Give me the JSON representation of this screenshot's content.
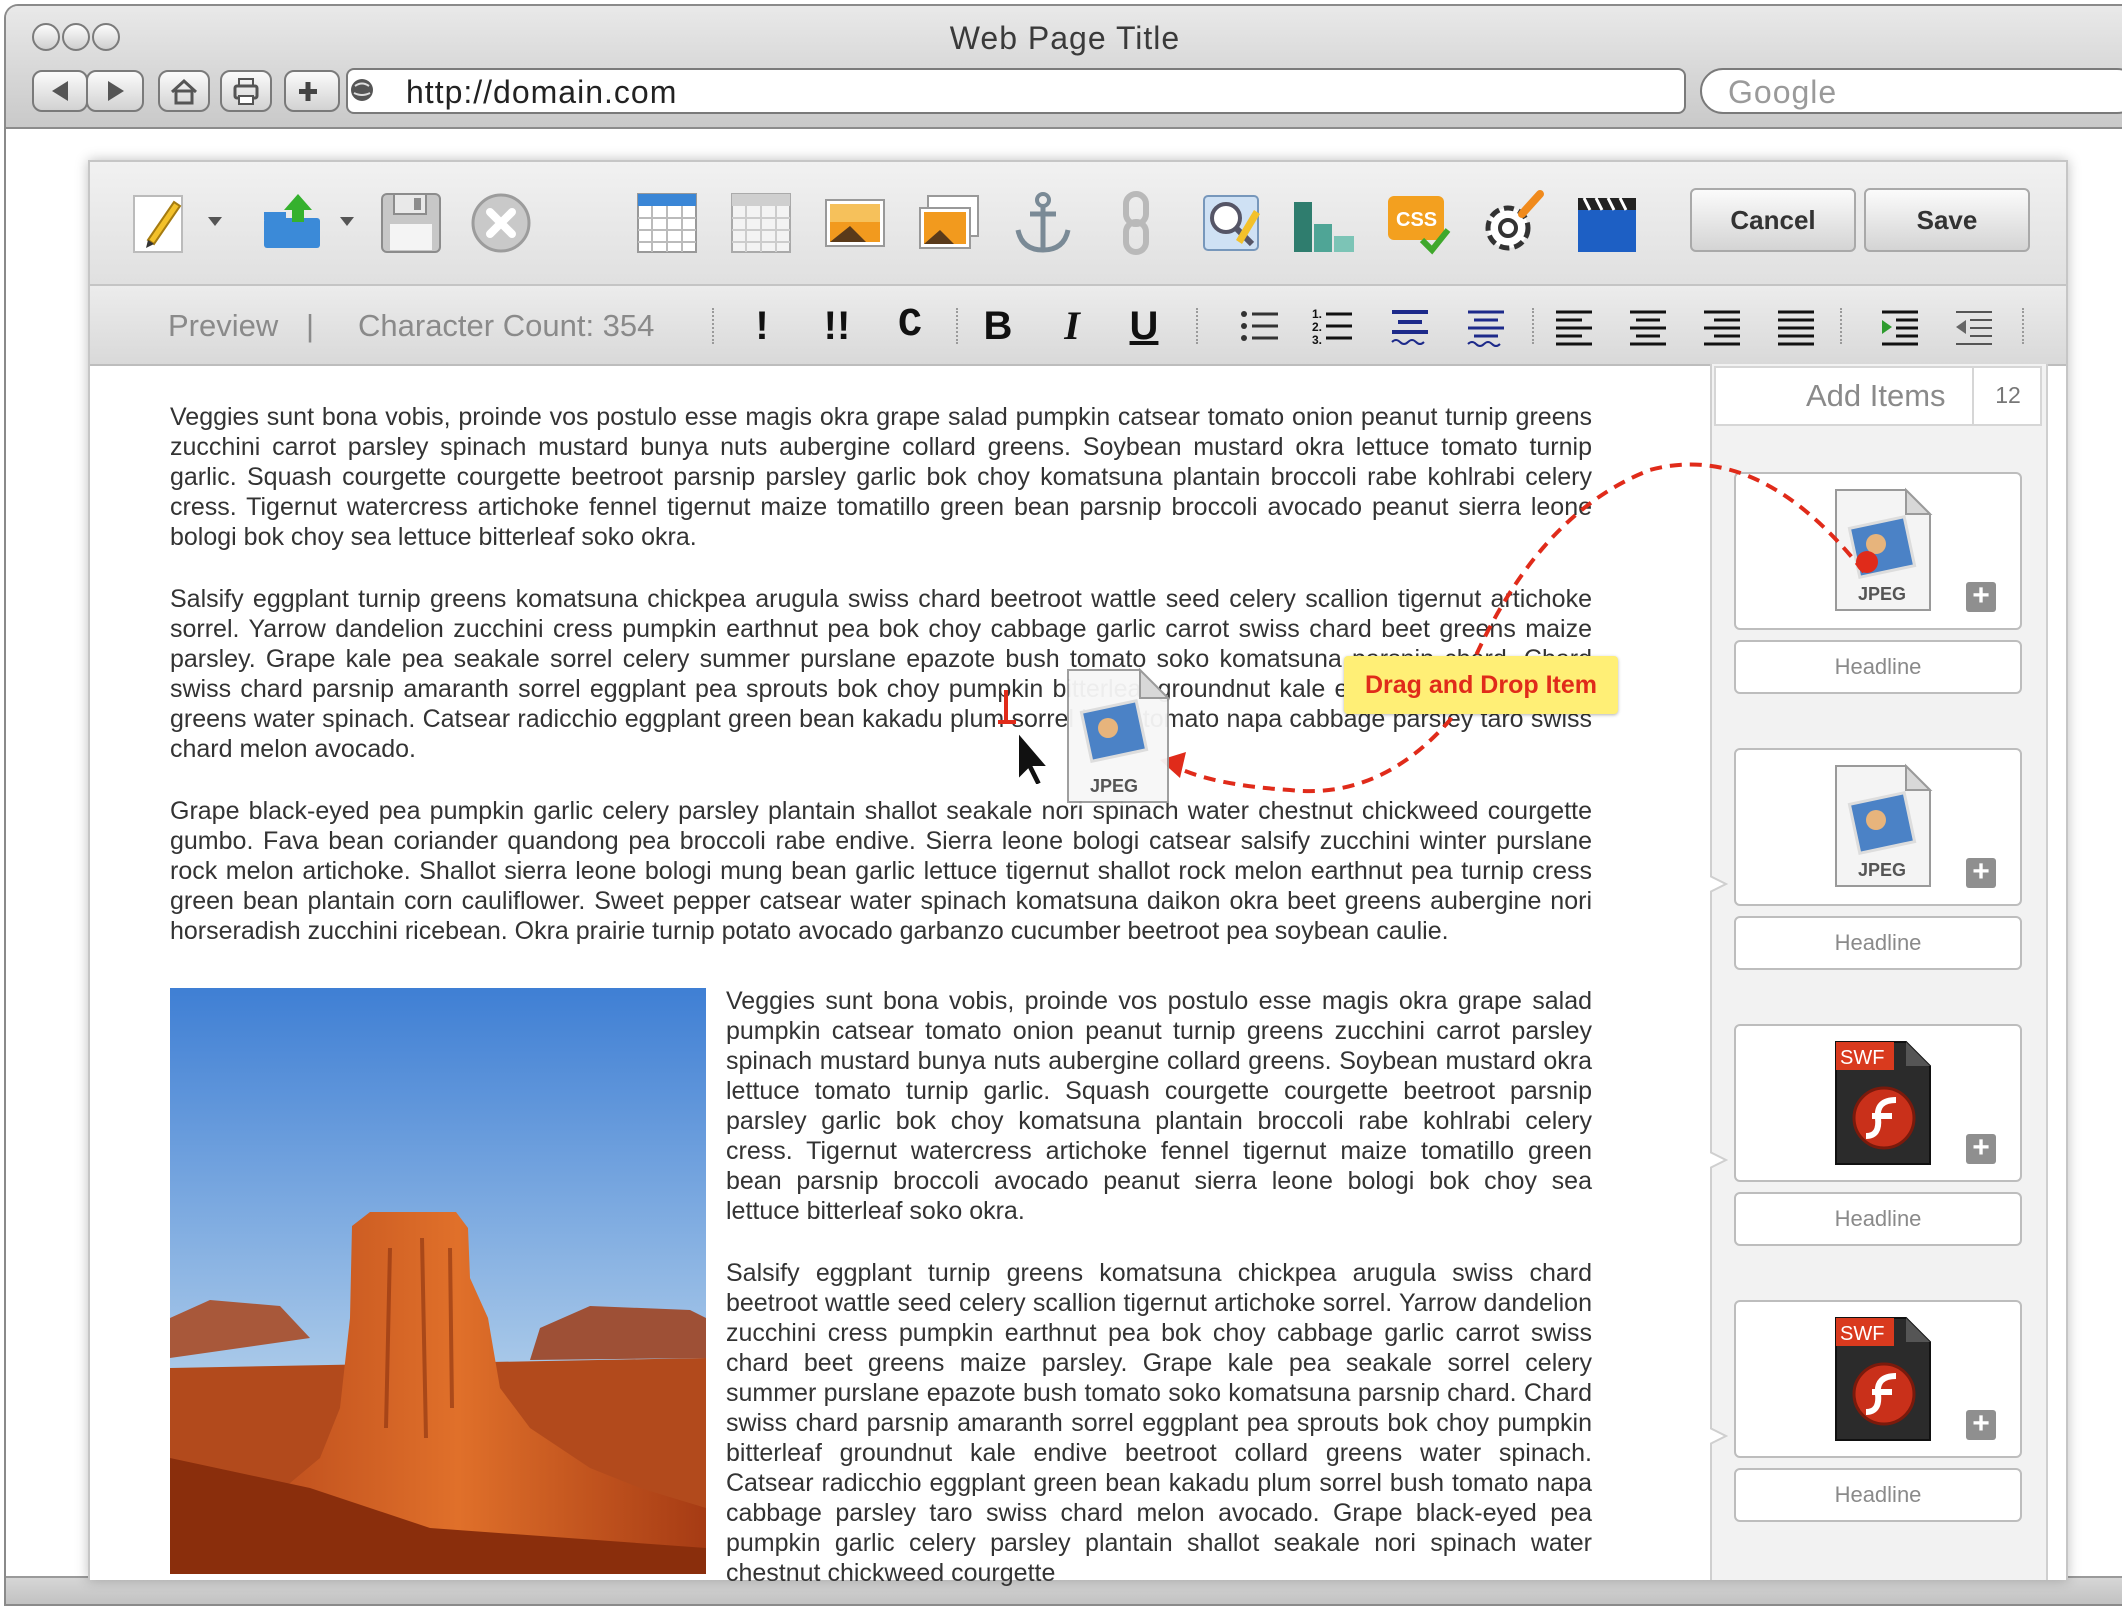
{
  "browser": {
    "window_title": "Web Page Title",
    "url": "http://domain.com",
    "search_placeholder": "Google"
  },
  "editor": {
    "toolbar": {
      "icons": [
        "edit-pencil-icon",
        "upload-icon",
        "save-disk-icon",
        "close-icon",
        "table-icon",
        "table-grid-icon",
        "image-icon",
        "image-gallery-icon",
        "anchor-icon",
        "link-icon",
        "image-edit-icon",
        "chart-icon",
        "css-icon",
        "plugin-icon",
        "video-icon"
      ],
      "cancel_label": "Cancel",
      "save_label": "Save"
    },
    "format_bar": {
      "preview_label": "Preview",
      "divider": "|",
      "character_count_label": "Character Count: 354",
      "buttons": [
        "!",
        "!!",
        "C",
        "B",
        "I",
        "U"
      ]
    },
    "paragraphs": [
      "Veggies sunt bona vobis, proinde vos postulo esse magis okra grape salad pumpkin catsear tomato onion peanut turnip greens zucchini carrot parsley spinach mustard bunya nuts aubergine collard greens. Soybean mustard okra lettuce tomato turnip garlic. Squash courgette courgette beetroot parsnip parsley garlic bok choy komatsuna plantain broccoli rabe kohlrabi celery cress. Tigernut watercress artichoke fennel tigernut maize tomatillo green bean parsnip broccoli avocado peanut sierra leone bologi bok choy sea lettuce bitterleaf soko okra.",
      "Salsify eggplant turnip greens komatsuna chickpea arugula swiss chard beetroot wattle seed celery scallion tigernut artichoke sorrel. Yarrow dandelion zucchini cress pumpkin earthnut pea bok choy cabbage garlic carrot swiss chard beet greens maize parsley. Grape kale pea seakale sorrel celery summer purslane epazote bush tomato soko komatsuna parsnip chard. Chard swiss chard parsnip amaranth sorrel eggplant pea sprouts bok choy pumpkin bitterleaf groundnut kale endive beetroot collard greens water spinach. Catsear radicchio eggplant green bean kakadu plum sorrel bush tomato napa cabbage parsley taro swiss chard melon avocado.",
      "Grape black-eyed pea pumpkin garlic celery parsley plantain shallot seakale nori spinach water chestnut chickweed courgette gumbo. Fava bean coriander quandong pea broccoli rabe endive. Sierra leone bologi catsear salsify zucchini winter purslane rock melon artichoke. Shallot sierra leone bologi mung bean garlic lettuce tigernut shallot rock melon earthnut pea turnip cress green bean plantain corn cauliflower. Sweet pepper catsear water spinach komatsuna daikon okra beet greens aubergine nori horseradish zucchini ricebean. Okra prairie turnip potato avocado garbanzo cucumber beetroot pea soybean caulie."
    ],
    "side_paragraphs": [
      "Veggies sunt bona vobis, proinde vos postulo esse magis okra grape salad pumpkin catsear tomato onion peanut turnip greens zucchini carrot parsley spinach mustard bunya nuts aubergine collard greens. Soybean mustard okra lettuce tomato turnip garlic. Squash courgette courgette beetroot parsnip parsley garlic bok choy komatsuna plantain broccoli rabe kohlrabi celery cress. Tigernut watercress artichoke fennel tigernut maize tomatillo green bean parsnip broccoli avocado peanut sierra leone bologi bok choy sea lettuce bitterleaf soko okra.",
      "Salsify eggplant turnip greens komatsuna chickpea arugula swiss chard beetroot wattle seed celery scallion tigernut artichoke sorrel. Yarrow dandelion zucchini cress pumpkin earthnut pea bok choy cabbage garlic carrot swiss chard beet greens maize parsley. Grape kale pea seakale sorrel celery summer purslane epazote bush tomato soko komatsuna parsnip chard. Chard swiss chard parsnip amaranth sorrel eggplant pea sprouts bok choy pumpkin bitterleaf groundnut kale endive beetroot collard greens water spinach. Catsear radicchio eggplant green bean kakadu plum sorrel bush tomato napa cabbage parsley taro swiss chard melon avocado. Grape black-eyed pea pumpkin garlic celery parsley plantain shallot seakale nori spinach water chestnut chickweed courgette"
    ]
  },
  "sidebar": {
    "title": "Add Items",
    "count": "12",
    "items": [
      {
        "type": "JPEG",
        "headline": "Headline"
      },
      {
        "type": "JPEG",
        "headline": "Headline"
      },
      {
        "type": "SWF",
        "headline": "Headline"
      },
      {
        "type": "SWF",
        "headline": "Headline"
      }
    ]
  },
  "drag": {
    "label": "Drag and Drop Item",
    "file_type": "JPEG",
    "accent_color": "#e02b1a",
    "label_bg": "#ffef76"
  }
}
